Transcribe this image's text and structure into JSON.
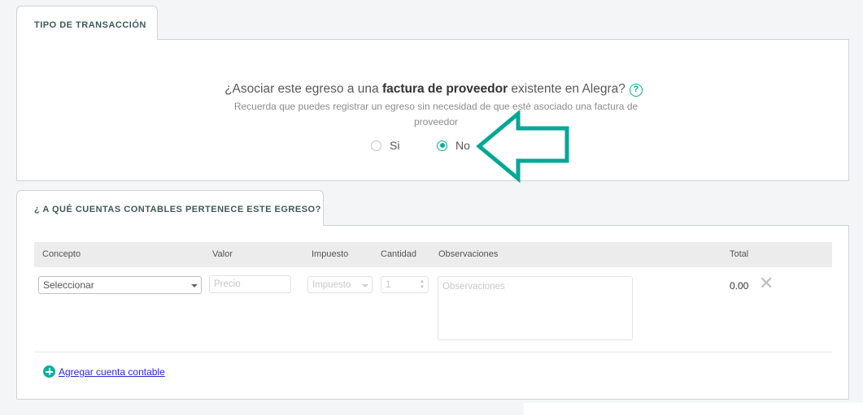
{
  "transaction_type": {
    "tab_label": "TIPO DE TRANSACCIÓN",
    "question_pre": "¿Asociar este egreso a una ",
    "question_bold": "factura de proveedor",
    "question_post": " existente en Alegra?",
    "help_symbol": "?",
    "hint": "Recuerda que puedes registrar un egreso sin necesidad de que esté asociado una factura de proveedor",
    "options": [
      {
        "label": "Si",
        "checked": false
      },
      {
        "label": "No",
        "checked": true
      }
    ]
  },
  "accounts": {
    "tab_label": "¿ A QUÉ CUENTAS CONTABLES PERTENECE ESTE EGRESO?",
    "columns": [
      "Concepto",
      "Valor",
      "Impuesto",
      "Cantidad",
      "Observaciones",
      "Total"
    ],
    "row": {
      "concepto_value": "Seleccionar",
      "valor_placeholder": "Precio",
      "impuesto_value": "Impuesto",
      "cantidad_value": "1",
      "observaciones_placeholder": "Observaciones",
      "total": "0.00"
    },
    "add_label": "Agregar cuenta contable"
  },
  "colors": {
    "accent": "#00b19d",
    "link": "#2a2ad6",
    "tab_text": "#3d5a55"
  },
  "icons": [
    "help-icon",
    "arrow-icon",
    "chevron-down-icon",
    "close-icon",
    "plus-circle-icon"
  ]
}
